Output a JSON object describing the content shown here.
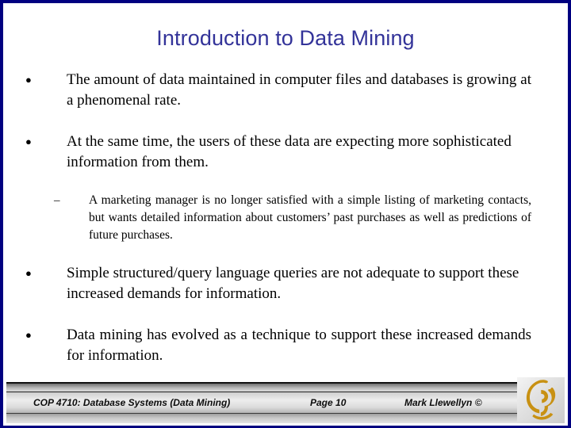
{
  "slide": {
    "title": "Introduction to Data Mining",
    "title_color": "#333399",
    "border_color": "#000080",
    "background_color": "#ffffff"
  },
  "content": {
    "bullets": [
      {
        "level": 1,
        "marker": "●",
        "text": "The amount of data maintained in computer files and databases is growing at a phenomenal rate."
      },
      {
        "level": 1,
        "marker": "●",
        "text": "At the same time, the users of these data are expecting more sophisticated information from them."
      },
      {
        "level": 2,
        "marker": "–",
        "text": "A marketing manager is no longer satisfied with a simple listing of marketing contacts, but wants detailed information about customers’ past purchases as well as predictions of future purchases."
      },
      {
        "level": 1,
        "marker": "●",
        "text": "Simple structured/query language queries are not adequate to support these increased demands for information."
      },
      {
        "level": 1,
        "marker": "●",
        "text": "Data mining has evolved as a technique to support these increased demands for information."
      }
    ]
  },
  "footer": {
    "course": "COP 4710: Database Systems  (Data Mining)",
    "page": "Page 10",
    "author": "Mark Llewellyn ©",
    "logo_name": "ucf-pegasus-logo",
    "logo_color": "#c89113"
  }
}
